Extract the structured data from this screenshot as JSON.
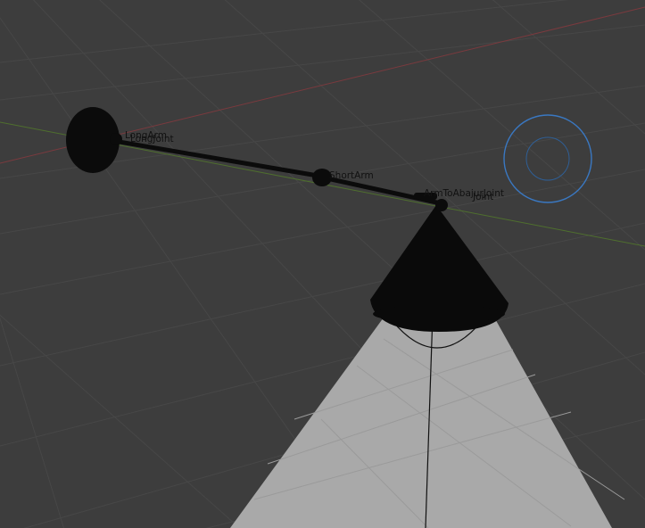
{
  "viewport": {
    "background": "#3d3d3d",
    "grid_color": "#484848",
    "x_axis_color": "#7a3a3e",
    "y_axis_color": "#4f6f2e",
    "selection_color": "#3a78c2",
    "spot_fill_color": "#a9a9a9"
  },
  "labels": {
    "long_arm": "LongArm",
    "long_joint": "LongJoint",
    "short_arm": "ShortArm",
    "arm_to_abajur_joint": "ArmToAbajurJoint",
    "joint_label": "Joint"
  },
  "icons": {
    "light_gizmo": "light-selection-ring-icon"
  }
}
